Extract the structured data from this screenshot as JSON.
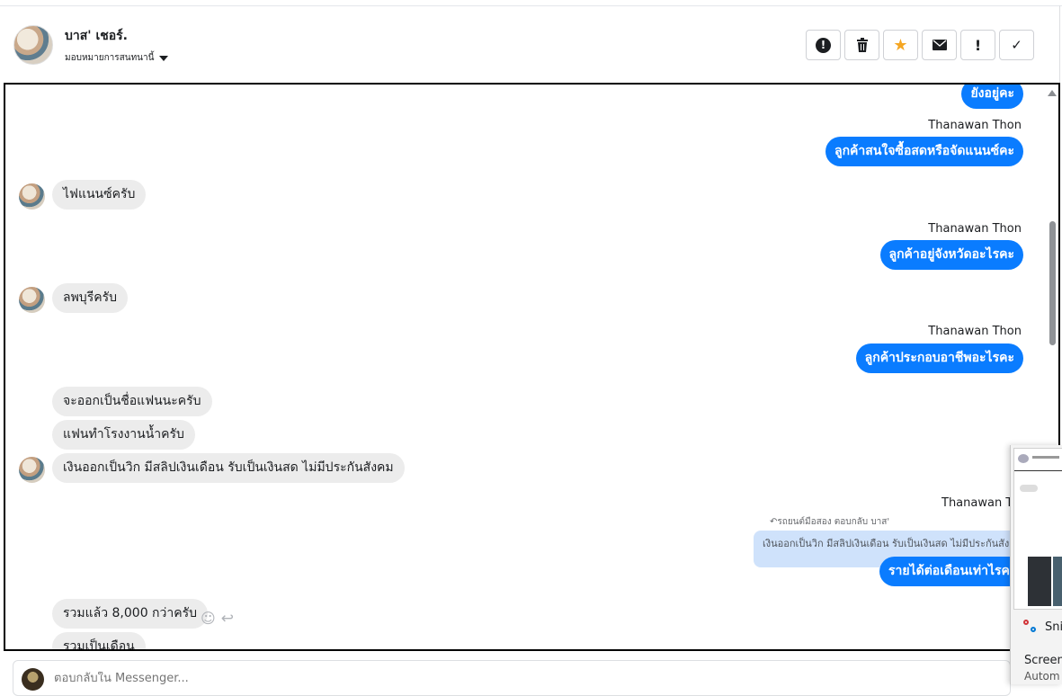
{
  "header": {
    "contact_name": "บาส' เชอร์.",
    "assign_label": "มอบหมายการสนทนานี้",
    "actions": [
      {
        "name": "report",
        "glyph": "❗"
      },
      {
        "name": "delete",
        "glyph": "🗑"
      },
      {
        "name": "star",
        "glyph": "★"
      },
      {
        "name": "mail",
        "glyph": "✉"
      },
      {
        "name": "important",
        "glyph": "!"
      },
      {
        "name": "done",
        "glyph": "✓"
      }
    ],
    "star_color": "#f5a623"
  },
  "chat": {
    "sender_name": "Thanawan Thon",
    "messages": [
      {
        "dir": "out",
        "text": "ยังอยู่คะ"
      },
      {
        "dir": "out",
        "sender": "Thanawan Thon",
        "text": "ลูกค้าสนใจซื้อสดหรือจัดแนนซ์คะ"
      },
      {
        "dir": "in",
        "text": "ไฟแนนซ์ครับ"
      },
      {
        "dir": "out",
        "sender": "Thanawan Thon",
        "text": "ลูกค้าอยู่จังหวัดอะไรคะ"
      },
      {
        "dir": "in",
        "text": "ลพบุรีครับ"
      },
      {
        "dir": "out",
        "sender": "Thanawan Thon",
        "text": "ลูกค้าประกอบอาชีพอะไรคะ"
      },
      {
        "dir": "in",
        "text": "จะออกเป็นชื่อแฟนนะครับ"
      },
      {
        "dir": "in",
        "text": "แฟนทำโรงงานน้ำครับ"
      },
      {
        "dir": "in",
        "text": "เงินออกเป็นวิก มีสลิปเงินเดือน รับเป็นเงินสด ไม่มีประกันสังคม"
      },
      {
        "dir": "out",
        "sender": "Thanawan Thon",
        "reply_label": "รถยนต์มือสอง ตอบกลับ บาส'",
        "quoted": "เงินออกเป็นวิก มีสลิปเงินเดือน รับเป็นเงินสด ไม่มีประกันสังคม",
        "text": "รายได้ต่อเดือนเท่าไรคะ"
      },
      {
        "dir": "in",
        "text": "รวมแล้ว 8,000 กว่าครับ"
      },
      {
        "dir": "in",
        "text": "รวมเป็นเดือน"
      }
    ]
  },
  "composer": {
    "placeholder": "ตอบกลับใน Messenger..."
  },
  "snip_popup": {
    "app_name": "Snip",
    "title": "Screen",
    "subtitle": "Autom"
  },
  "colors": {
    "outgoing_bubble": "#0a7cff",
    "incoming_bubble": "#ececec",
    "quoted_bubble": "#cfe2fb"
  }
}
